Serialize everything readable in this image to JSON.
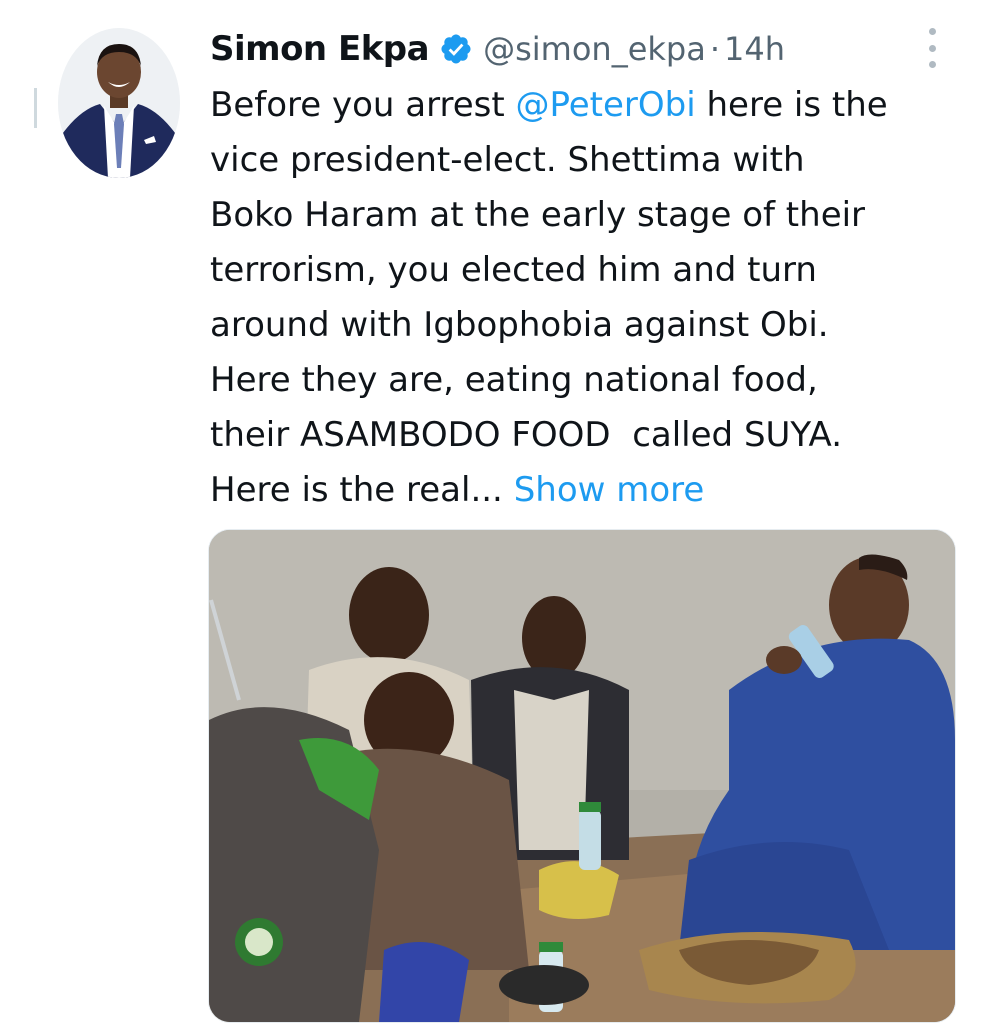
{
  "tweet": {
    "author": {
      "name": "Simon Ekpa",
      "handle": "@simon_ekpa",
      "verified": true,
      "verified_color": "#1d9bf0"
    },
    "separator": "·",
    "time": "14h",
    "text": {
      "line1_pre": "Before you arrest ",
      "mention": "@PeterObi",
      "line1_post": " here is the",
      "line2": "vice president-elect. Shettima with",
      "line3": "Boko Haram at the early stage of their",
      "line4": "terrorism, you elected him and turn",
      "line5": "around with Igbophobia against Obi.",
      "line6": "Here they are, eating national food,",
      "line7": "their ASAMBODO FOOD  called SUYA.",
      "line8": "Here is the real... ",
      "show_more": "Show more"
    },
    "media": {
      "type": "photo"
    }
  },
  "icons": {
    "verified": "verified-badge-icon",
    "more": "more-options-icon"
  },
  "colors": {
    "link": "#1d9bf0",
    "secondary_text": "#536471",
    "primary_text": "#0f1419"
  }
}
